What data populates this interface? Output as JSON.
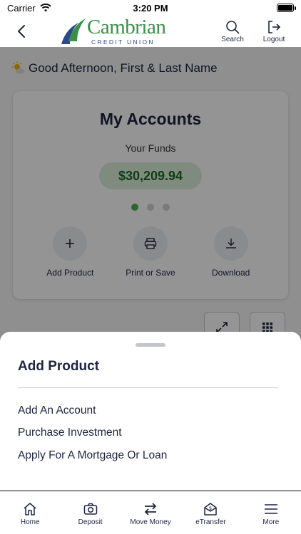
{
  "status_bar": {
    "carrier": "Carrier",
    "time": "3:20 PM"
  },
  "header": {
    "logo_name": "Cambrian",
    "logo_sub": "CREDIT UNION",
    "search_label": "Search",
    "logout_label": "Logout",
    "icons": {
      "back": "chevron-left-icon",
      "search": "search-icon",
      "logout": "logout-icon"
    }
  },
  "greeting": "Good Afternoon, First & Last Name",
  "accounts_card": {
    "title": "My Accounts",
    "funds_label": "Your Funds",
    "funds_value": "$30,209.94",
    "carousel": {
      "pages": 3,
      "active_page": 1
    },
    "actions": [
      {
        "label": "Add Product",
        "icon": "plus-icon"
      },
      {
        "label": "Print or Save",
        "icon": "printer-icon"
      },
      {
        "label": "Download",
        "icon": "download-icon"
      }
    ]
  },
  "view_controls": {
    "icons": [
      "expand-icon",
      "grid-icon"
    ]
  },
  "sheet": {
    "title": "Add Product",
    "options": [
      "Add An Account",
      "Purchase Investment",
      "Apply For A Mortgage Or Loan"
    ]
  },
  "tab_bar": {
    "tabs": [
      {
        "label": "Home",
        "icon": "home-icon"
      },
      {
        "label": "Deposit",
        "icon": "camera-icon"
      },
      {
        "label": "Move Money",
        "icon": "transfer-icon"
      },
      {
        "label": "eTransfer",
        "icon": "etransfer-icon"
      },
      {
        "label": "More",
        "icon": "menu-icon"
      }
    ]
  },
  "colors": {
    "primary_text": "#1f2440",
    "brand_green": "#3a8f47",
    "brand_blue": "#2b4a8c",
    "funds_pill_bg": "#dcf0dd",
    "funds_pill_text": "#1d6b2b",
    "carousel_active": "#4caf50"
  }
}
